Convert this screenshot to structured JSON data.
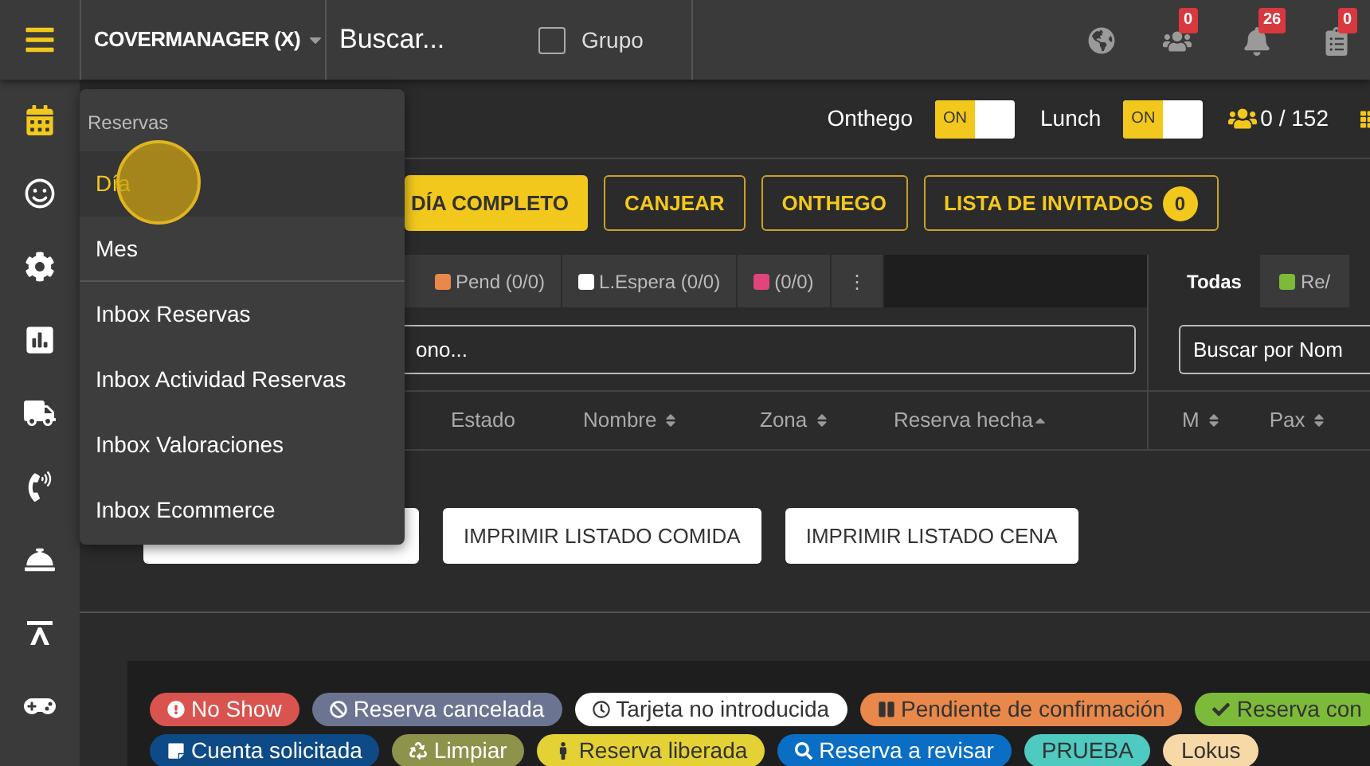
{
  "topbar": {
    "venue": "COVERMANAGER (X)",
    "search": {
      "placeholder": "Buscar..."
    },
    "group_checkbox": {
      "label": "Grupo",
      "checked": false
    },
    "badges": [
      {
        "count": "0"
      },
      {
        "count": "26"
      },
      {
        "count": "0"
      }
    ]
  },
  "menu": {
    "header": "Reservas",
    "items": [
      {
        "label": "Día",
        "selected": true,
        "divider_after": false
      },
      {
        "label": "Mes",
        "selected": false,
        "divider_after": true
      },
      {
        "label": "Inbox Reservas",
        "selected": false,
        "divider_after": false
      },
      {
        "label": "Inbox Actividad Reservas",
        "selected": false,
        "divider_after": false
      },
      {
        "label": "Inbox Valoraciones",
        "selected": false,
        "divider_after": false
      },
      {
        "label": "Inbox Ecommerce",
        "selected": false,
        "divider_after": false
      }
    ]
  },
  "sidebar": {
    "items": [
      {
        "selected": true
      },
      {
        "selected": false
      },
      {
        "selected": false
      },
      {
        "selected": false
      },
      {
        "selected": false
      },
      {
        "selected": false
      },
      {
        "selected": false
      },
      {
        "selected": false
      },
      {
        "selected": false
      }
    ]
  },
  "status": {
    "toggles": [
      {
        "label": "Onthego",
        "state_text": "ON",
        "on": true
      },
      {
        "label": "Lunch",
        "state_text": "ON",
        "on": true
      }
    ],
    "covers": "0 / 152"
  },
  "actions": [
    {
      "label": "DÍA COMPLETO",
      "kind": "filled"
    },
    {
      "label": "CANJEAR",
      "kind": "outline"
    },
    {
      "label": "ONTHEGO",
      "kind": "outline"
    },
    {
      "label": "LISTA DE INVITADOS",
      "kind": "outline",
      "count": "0"
    }
  ],
  "filter_tabs": [
    {
      "label": "Pend (0/0)",
      "color": "#e8884a",
      "selected": false
    },
    {
      "label": "L.Espera (0/0)",
      "color": "#ffffff",
      "selected": false
    },
    {
      "label": "(0/0)",
      "color": "#e0457b",
      "selected": false
    },
    {
      "label": "⋮",
      "selected": false
    }
  ],
  "right_tabs": [
    {
      "label": "Todas",
      "selected": true
    },
    {
      "label": "Re/",
      "color": "#7cbb3a",
      "selected": false
    }
  ],
  "search_left": {
    "placeholder": "ono..."
  },
  "search_right": {
    "placeholder": "Buscar por Nom"
  },
  "columns": [
    {
      "label": "Estado",
      "sortable": false,
      "sorted": false
    },
    {
      "label": "Nombre",
      "sortable": true,
      "sorted": false
    },
    {
      "label": "Zona",
      "sortable": true,
      "sorted": false
    },
    {
      "label": "Reserva hecha",
      "sortable": true,
      "sorted": true
    }
  ],
  "right_columns": [
    {
      "label": "M",
      "sortable": true,
      "sorted": false
    },
    {
      "label": "Pax",
      "sortable": true,
      "sorted": false
    }
  ],
  "print_buttons": [
    {
      "label": "IMPRIMIR LISTADO COMIDA"
    },
    {
      "label": "IMPRIMIR LISTADO CENA"
    }
  ],
  "legend": [
    [
      {
        "label": "No Show",
        "color": "#d9534f"
      },
      {
        "label": "Reserva cancelada",
        "color": "#6b7591"
      },
      {
        "label": "Tarjeta no introducida",
        "color": "#ffffff"
      },
      {
        "label": "Pendiente de confirmación",
        "color": "#e8884a"
      },
      {
        "label": "Reserva con",
        "color": "#7cbb3a"
      }
    ],
    [
      {
        "label": "Cuenta solicitada",
        "color": "#0d4a86"
      },
      {
        "label": "Limpiar",
        "color": "#8e934c"
      },
      {
        "label": "Reserva liberada",
        "color": "#e3d136"
      },
      {
        "label": "Reserva a revisar",
        "color": "#0a6ec4"
      },
      {
        "label": "PRUEBA",
        "color": "#4ecac1"
      },
      {
        "label": "Lokus",
        "color": "#f6d9a6"
      }
    ]
  ]
}
